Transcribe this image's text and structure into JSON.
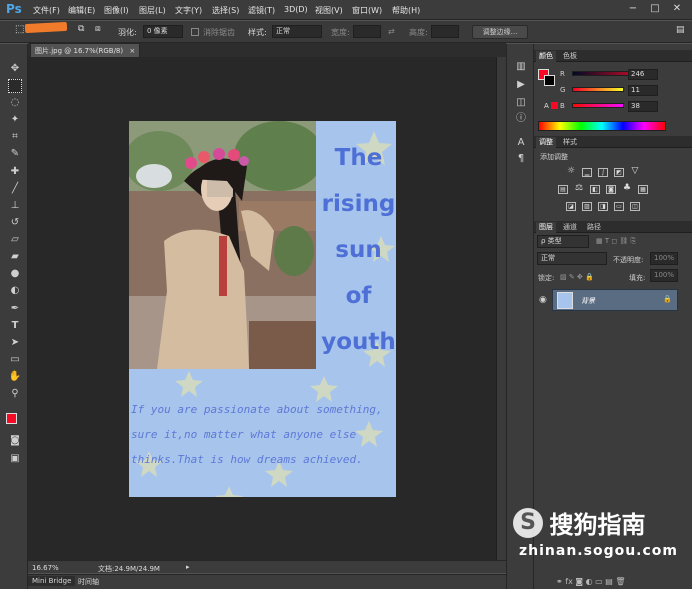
{
  "app": {
    "logo": "Ps"
  },
  "menu": [
    "文件(F)",
    "编辑(E)",
    "图像(I)",
    "图层(L)",
    "文字(Y)",
    "选择(S)",
    "滤镜(T)",
    "3D(D)",
    "视图(V)",
    "窗口(W)",
    "帮助(H)"
  ],
  "window_controls": {
    "minimize": "−",
    "restore": "□",
    "close": "✕"
  },
  "options": {
    "feather_label": "羽化:",
    "feather_value": "0 像素",
    "antialias_label": "消除锯齿",
    "style_label": "样式:",
    "style_value": "正常",
    "width_label": "宽度:",
    "height_label": "高度:",
    "refine_button": "调整边缘..."
  },
  "document": {
    "tab_title": "图片.jpg @ 16.7%(RGB/8)",
    "tab_close": "×",
    "title_lines": [
      "The",
      "rising",
      "sun",
      "of",
      "youth"
    ],
    "quote_lines": [
      "If you are passionate about something,",
      "sure it,no matter what anyone else",
      "thinks.That is how dreams achieved."
    ]
  },
  "status": {
    "zoom": "16.67%",
    "doc_info": "文档:24.9M/24.9M"
  },
  "bottom_tabs": [
    "Mini Bridge",
    "时间轴"
  ],
  "color_panel": {
    "tabs": [
      "颜色",
      "色板"
    ],
    "channels": [
      {
        "label": "R",
        "value": "246"
      },
      {
        "label": "G",
        "value": "11"
      },
      {
        "label": "B",
        "value": "38"
      }
    ],
    "foreground_color": "#f60b26",
    "background_color": "#000000"
  },
  "adjust_panel": {
    "tabs": [
      "调整",
      "样式"
    ],
    "heading": "添加调整"
  },
  "layers_panel": {
    "tabs": [
      "图层",
      "通道",
      "路径"
    ],
    "kind_label": "ρ 类型",
    "blend_mode": "正常",
    "opacity_label": "不透明度:",
    "opacity_value": "100%",
    "lock_label": "锁定:",
    "fill_label": "填充:",
    "fill_value": "100%",
    "layer_name": "背景"
  },
  "watermark": {
    "logo_text": "搜狗指南",
    "url": "zhinan.sogou.com"
  },
  "colors": {
    "accent_arrow": "#f07b2a",
    "image_bg": "#a7c4ec",
    "title_text": "#4d6fd6",
    "layer_selected": "#5a6c82"
  }
}
